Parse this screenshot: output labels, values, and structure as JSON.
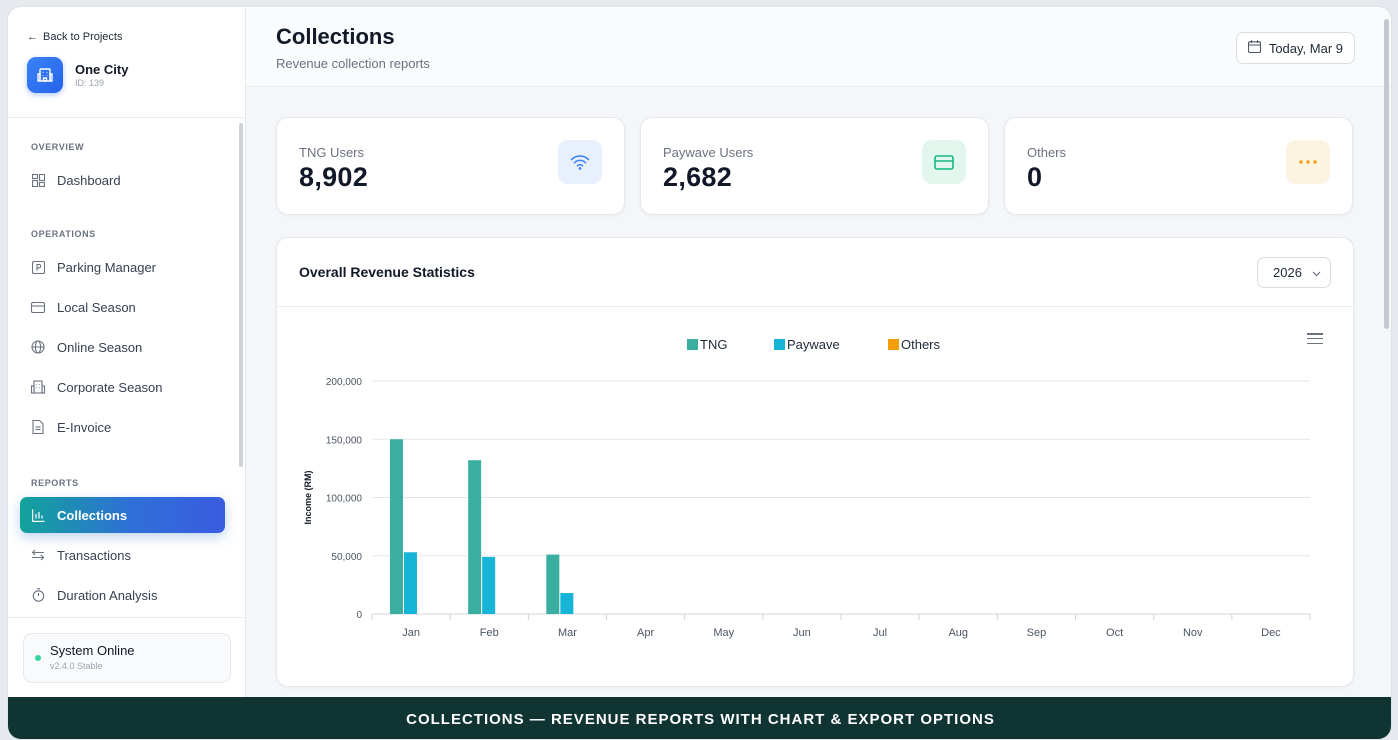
{
  "sidebar": {
    "back_label": "Back to Projects",
    "project_name": "One City",
    "project_id": "ID: 139",
    "sections": {
      "overview": "OVERVIEW",
      "operations": "OPERATIONS",
      "reports": "REPORTS"
    },
    "items": [
      {
        "label": "Dashboard",
        "icon": "grid-icon"
      },
      {
        "label": "Parking Manager",
        "icon": "parking-icon"
      },
      {
        "label": "Local Season",
        "icon": "card-icon"
      },
      {
        "label": "Online Season",
        "icon": "globe-icon"
      },
      {
        "label": "Corporate Season",
        "icon": "building-icon"
      },
      {
        "label": "E-Invoice",
        "icon": "document-icon"
      },
      {
        "label": "Collections",
        "icon": "bar-chart-icon",
        "active": true
      },
      {
        "label": "Transactions",
        "icon": "arrows-icon"
      },
      {
        "label": "Duration Analysis",
        "icon": "stopwatch-icon"
      }
    ],
    "status": {
      "title": "System Online",
      "version": "v2.4.0 Stable",
      "color": "#34d399"
    }
  },
  "header": {
    "title": "Collections",
    "subtitle": "Revenue collection reports",
    "date_label": "Today, Mar 9"
  },
  "stats": [
    {
      "label": "TNG Users",
      "value": "8,902",
      "icon": "wifi-icon",
      "color": "#3b82f6"
    },
    {
      "label": "Paywave Users",
      "value": "2,682",
      "icon": "card-icon",
      "color": "#10b981"
    },
    {
      "label": "Others",
      "value": "0",
      "icon": "dots-icon",
      "color": "#f59e0b"
    }
  ],
  "chart": {
    "title": "Overall Revenue Statistics",
    "year": "2026"
  },
  "chart_data": {
    "type": "bar",
    "title": "",
    "xlabel": "",
    "ylabel": "Income (RM)",
    "ylim": [
      0,
      200000
    ],
    "yticks": [
      "0",
      "50,000",
      "100,000",
      "150,000",
      "200,000"
    ],
    "categories": [
      "Jan",
      "Feb",
      "Mar",
      "Apr",
      "May",
      "Jun",
      "Jul",
      "Aug",
      "Sep",
      "Oct",
      "Nov",
      "Dec"
    ],
    "series": [
      {
        "name": "TNG",
        "color": "#3aaea0",
        "values": [
          150000,
          132000,
          51000,
          0,
          0,
          0,
          0,
          0,
          0,
          0,
          0,
          0
        ]
      },
      {
        "name": "Paywave",
        "color": "#16b4d6",
        "values": [
          53000,
          49000,
          18000,
          0,
          0,
          0,
          0,
          0,
          0,
          0,
          0,
          0
        ]
      },
      {
        "name": "Others",
        "color": "#f59e0b",
        "values": [
          0,
          0,
          0,
          0,
          0,
          0,
          0,
          0,
          0,
          0,
          0,
          0
        ]
      }
    ],
    "grid": true,
    "legend": "top-center"
  },
  "banner": "COLLECTIONS — REVENUE REPORTS WITH CHART & EXPORT OPTIONS"
}
